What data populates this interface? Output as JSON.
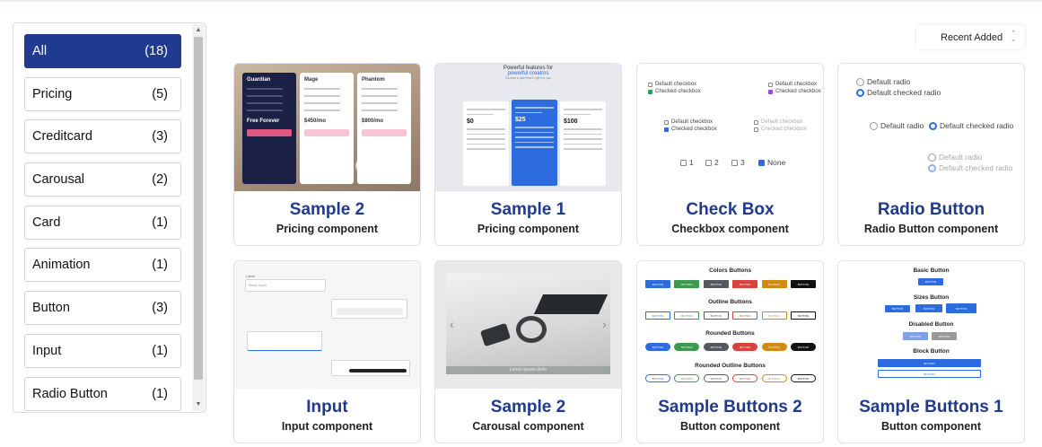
{
  "categories": [
    {
      "label": "All",
      "count": "(18)",
      "active": true
    },
    {
      "label": "Pricing",
      "count": "(5)"
    },
    {
      "label": "Creditcard",
      "count": "(3)"
    },
    {
      "label": "Carousal",
      "count": "(2)"
    },
    {
      "label": "Card",
      "count": "(1)"
    },
    {
      "label": "Animation",
      "count": "(1)"
    },
    {
      "label": "Button",
      "count": "(3)"
    },
    {
      "label": "Input",
      "count": "(1)"
    },
    {
      "label": "Radio Button",
      "count": "(1)"
    }
  ],
  "sort": {
    "label": "Recent Added"
  },
  "cards": [
    {
      "title": "Sample 2",
      "subtitle": "Pricing component"
    },
    {
      "title": "Sample 1",
      "subtitle": "Pricing component"
    },
    {
      "title": "Check Box",
      "subtitle": "Checkbox component"
    },
    {
      "title": "Radio Button",
      "subtitle": "Radio Button component"
    },
    {
      "title": "Input",
      "subtitle": "Input component"
    },
    {
      "title": "Sample 2",
      "subtitle": "Carousal component"
    },
    {
      "title": "Sample Buttons 2",
      "subtitle": "Button component"
    },
    {
      "title": "Sample Buttons 1",
      "subtitle": "Button component"
    }
  ],
  "thumb_pricing1": {
    "plans": [
      "Guardian",
      "Mage",
      "Phantom"
    ],
    "prices": [
      "Free Forever",
      "$450/mo",
      "$800/mo"
    ],
    "cta": "Choose"
  },
  "thumb_pricing2": {
    "heading": "Powerful features for",
    "heading_accent": "powerful creators",
    "subheading": "Choose a plan that's right for you",
    "prices": [
      "$0",
      "$25",
      "$100"
    ]
  },
  "thumb_checkbox": {
    "default": "Default checkbox",
    "checked": "Checked checkbox",
    "numbers": [
      "1",
      "2",
      "3"
    ],
    "none": "None"
  },
  "thumb_radio": {
    "default": "Default radio",
    "checked": "Default checked radio"
  },
  "thumb_input": {
    "label": "Label",
    "placeholder": "Basic Input"
  },
  "thumb_carousel": {
    "caption": "Lorem ipsum dolor"
  },
  "thumb_buttons2": {
    "sections": [
      "Colors Buttons",
      "Outline Buttons",
      "Rounded Buttons",
      "Rounded Outline Buttons"
    ],
    "button_label": "BUTTON",
    "colors": [
      "#2d6cdf",
      "#3d9a4b",
      "#555a61",
      "#d9433b",
      "#d18a14",
      "#111111"
    ]
  },
  "thumb_buttons1": {
    "sections": [
      "Basic Button",
      "Sizes Button",
      "Disabled Button",
      "Block Button"
    ],
    "button_label": "BUTTON"
  },
  "colors": {
    "accent": "#1f3a8f",
    "blue": "#2d6cdf"
  }
}
